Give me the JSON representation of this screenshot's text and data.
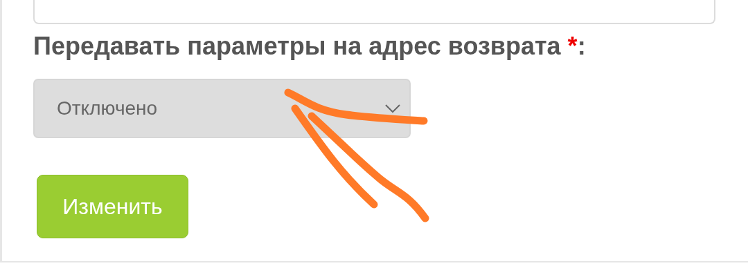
{
  "label": {
    "text": "Передавать параметры на адрес возврата",
    "required_mark": "*",
    "suffix": ":"
  },
  "select": {
    "value": "Отключено"
  },
  "submit_button": {
    "label": "Изменить"
  }
}
